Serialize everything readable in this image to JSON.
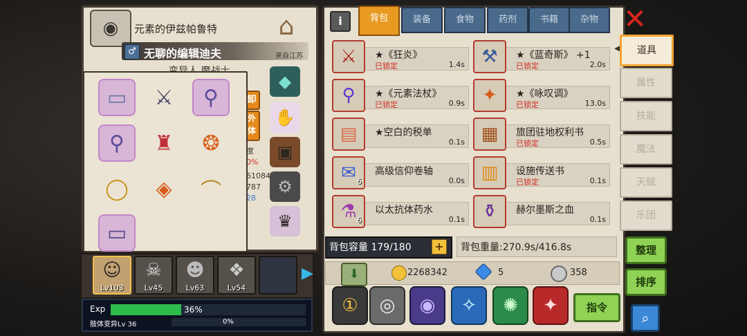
{
  "character": {
    "title": "元素的伊兹帕鲁特",
    "name": "无聊的编辑迪夫",
    "origin": "来自江苏",
    "class": "变异人 魔战士",
    "side_button_1": "卸",
    "side_button_2": "外\n体",
    "side_stat_1": "度",
    "side_stat_2": "0%",
    "side_stat_3": "61084",
    "side_stat_4": "787",
    "side_stat_5": "28"
  },
  "party": [
    {
      "level": "Lv103",
      "active": true
    },
    {
      "level": "Lv45",
      "active": false
    },
    {
      "level": "Lv63",
      "active": false
    },
    {
      "level": "Lv54",
      "active": false
    },
    {
      "level": "",
      "active": false
    }
  ],
  "exp": {
    "label": "Exp",
    "percent": 36,
    "percent_text": "36%",
    "sub_label": "肢体变异Lv 36",
    "sub_percent_text": "0%"
  },
  "tabs": [
    "背包",
    "装备",
    "食物",
    "药剂",
    "书籍",
    "杂物"
  ],
  "inventory": [
    {
      "name": "★《狂炎》",
      "locked": "已锁定",
      "weight": "1.4s",
      "icon": "sword-icon"
    },
    {
      "name": "★《蓝奇斯》 +1",
      "locked": "已锁定",
      "weight": "2.0s",
      "icon": "axe-icon"
    },
    {
      "name": "★《元素法杖》",
      "locked": "已锁定",
      "weight": "0.9s",
      "icon": "staff-icon"
    },
    {
      "name": "★《咏叹调》",
      "locked": "已锁定",
      "weight": "13.0s",
      "icon": "scepter-icon"
    },
    {
      "name": "★空白的税单",
      "locked": "",
      "weight": "0.1s",
      "icon": "ticket-icon"
    },
    {
      "name": "旅团驻地权利书",
      "locked": "已锁定",
      "weight": "0.5s",
      "icon": "deed-icon"
    },
    {
      "name": "高级信仰卷轴",
      "locked": "",
      "weight": "0.0s",
      "icon": "scroll-icon",
      "count": "6"
    },
    {
      "name": "设施传送书",
      "locked": "已锁定",
      "weight": "0.1s",
      "icon": "book-icon"
    },
    {
      "name": "以太抗体药水",
      "locked": "",
      "weight": "0.1s",
      "icon": "potion-icon",
      "count": "6"
    },
    {
      "name": "赫尔墨斯之血",
      "locked": "",
      "weight": "0.1s",
      "icon": "blood-potion-icon"
    }
  ],
  "capacity": {
    "label": "背包容量 179/180",
    "plus": "+"
  },
  "weight": {
    "label": "背包重量:270.9s/416.8s"
  },
  "currency": {
    "gold": "2268342",
    "gems": "5",
    "medals": "358"
  },
  "command_label": "指令",
  "side_menu": [
    "道具",
    "属性",
    "技能",
    "魔法",
    "天赋",
    "乐团"
  ],
  "sort_buttons": {
    "arrange": "整理",
    "order": "排序"
  },
  "colors": {
    "accent_orange": "#e89a22",
    "lock_red": "#d12a1f",
    "green_button": "#8fd255"
  }
}
